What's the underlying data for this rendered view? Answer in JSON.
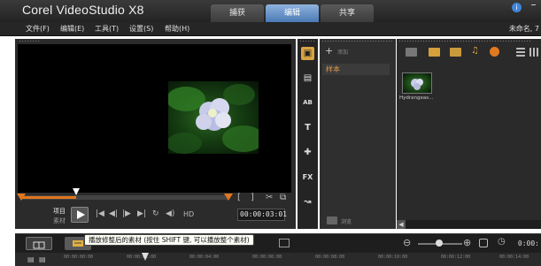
{
  "app": {
    "title": "Corel VideoStudio X8"
  },
  "tabs": [
    {
      "label": "捕获",
      "active": false
    },
    {
      "label": "编辑",
      "active": true
    },
    {
      "label": "共享",
      "active": false
    }
  ],
  "window": {
    "help_glyph": "i",
    "minimize_glyph": "–"
  },
  "menu": {
    "items": [
      "文件(F)",
      "编辑(E)",
      "工具(T)",
      "设置(S)",
      "帮助(H)"
    ],
    "project_name": "未命名, 7"
  },
  "player": {
    "mode_project": "项目",
    "mode_clip": "素材",
    "timecode": "00:00:03:01",
    "hd_label": "HD",
    "scrub_progress": 0.27,
    "controls": [
      "|◀",
      "◀|",
      "|▶",
      "▶|",
      "↻",
      "◀)"
    ],
    "trim_tools": [
      "[",
      "]",
      "✂",
      "⧉"
    ]
  },
  "library": {
    "tools": [
      "media-icon",
      "instant-project-icon",
      "transition-icon",
      "title-icon",
      "graphic-icon",
      "filter-icon",
      "path-icon"
    ],
    "tool_glyphs": [
      "▣",
      "▤",
      "AB",
      "T",
      "✚",
      "FX",
      "↝"
    ],
    "add_glyph": "+",
    "add_label": "添加",
    "nav_item": "样本",
    "browse_label": "浏览",
    "media_label": "Hydrangeas..."
  },
  "tooltip": "播放修整后的素材 (按住 SHIFT 键, 可以播放整个素材)",
  "timeline": {
    "time": "0:00:",
    "ruler_ticks": [
      "00:00:00:00",
      "00:00:02:00",
      "00:00:04:00",
      "00:00:06:00",
      "00:00:08:00",
      "00:00:10:00",
      "00:00:12:00",
      "00:00:14:00"
    ]
  },
  "colors": {
    "accent": "#e0761e",
    "tab_active": "#4a7ab5"
  }
}
